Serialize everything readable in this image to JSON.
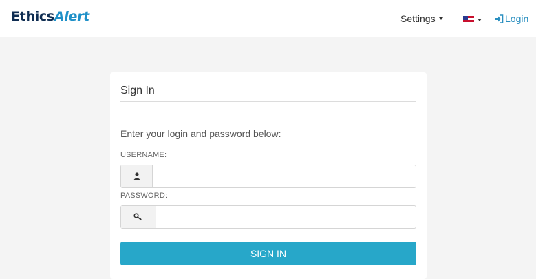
{
  "header": {
    "logo_part1": "Ethics",
    "logo_part2": "Alert",
    "settings_label": "Settings",
    "language_flag": "us-flag-icon",
    "login_label": "Login"
  },
  "login_card": {
    "title": "Sign In",
    "intro": "Enter your login and password below:",
    "username_label": "USERNAME:",
    "username_value": "",
    "password_label": "PASSWORD:",
    "password_value": "",
    "submit_label": "SIGN IN"
  },
  "colors": {
    "page_background": "#f4f4f4",
    "logo_dark": "#0f2d52",
    "logo_accent": "#1e90c8",
    "link": "#2a8fc0",
    "primary_button": "#27a7c9"
  }
}
